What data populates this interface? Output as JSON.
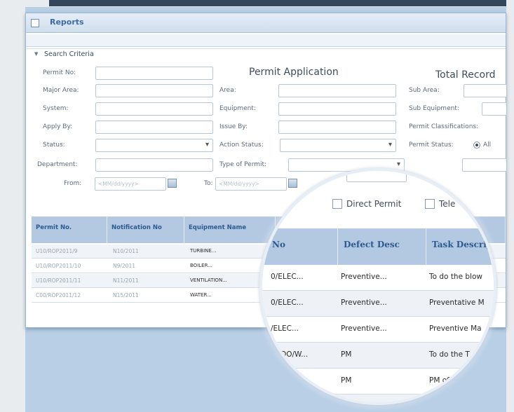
{
  "panel": {
    "title": "Reports",
    "search_criteria_label": "Search Criteria",
    "permit_application_title": "Permit Application",
    "total_record_label": "Total Record"
  },
  "form": {
    "permit_no": "Permit No:",
    "major_area": "Major Area:",
    "system": "System:",
    "apply_by": "Apply By:",
    "status": "Status:",
    "department": "Department:",
    "from": "From:",
    "area": "Area:",
    "equipment": "Equipment:",
    "issue_by": "Issue By:",
    "action_status": "Action Status:",
    "type_of_permit": "Type of Permit:",
    "to": "To:",
    "sub_area": "Sub Area:",
    "sub_equipment": "Sub Equipment:",
    "permit_classifications": "Permit Classifications:",
    "permit_status": "Permit Status:",
    "permit_status_all": "All",
    "date_placeholder": "<MM/dd/yyyy>",
    "cut_label": "- Permit"
  },
  "grid": {
    "columns": [
      "Permit No.",
      "Notification No",
      "Equipment Name"
    ],
    "rows": [
      {
        "permit": "U10/ROP2011/9",
        "notif": "N10/2011",
        "equip": "TURBINE..."
      },
      {
        "permit": "U10/ROP2011/10",
        "notif": "N9/2011",
        "equip": "BOILER..."
      },
      {
        "permit": "U10/ROP2011/11",
        "notif": "N11/2011",
        "equip": "VENTILATION..."
      },
      {
        "permit": "C00/ROP2011/12",
        "notif": "N15/2011",
        "equip": "WATER..."
      }
    ]
  },
  "magnifier": {
    "direct_permit": "Direct Permit",
    "tele_partial": "Tele",
    "columns": [
      "No",
      "Defect Desc",
      "Task Descrip"
    ],
    "rows": [
      {
        "c1": "0/ELEC...",
        "c2": "Preventive...",
        "c3": "To do the blow"
      },
      {
        "c1": "0/ELEC...",
        "c2": "Preventive...",
        "c3": "Preventative M"
      },
      {
        "c1": "/ELEC...",
        "c2": "Preventive...",
        "c3": "Preventive Ma"
      },
      {
        "c1": "ECOO/W...",
        "c2": "PM",
        "c3": "To do the T"
      },
      {
        "c1": "OO/W...",
        "c2": "PM",
        "c3": "PM of T"
      },
      {
        "c1": "",
        "c2": "PM",
        "c3": ""
      }
    ]
  }
}
